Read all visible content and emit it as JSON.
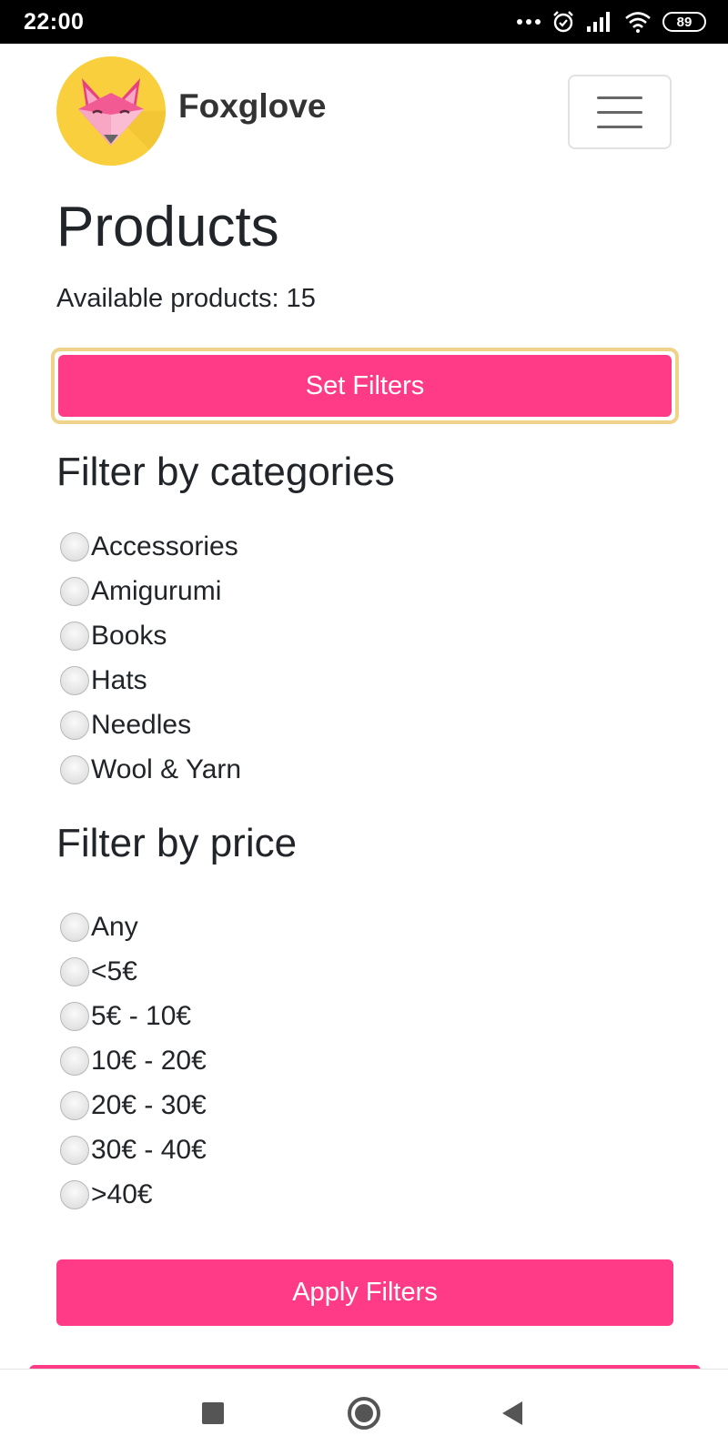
{
  "status_bar": {
    "time": "22:00",
    "battery": "89"
  },
  "header": {
    "brand_name": "Foxglove"
  },
  "main": {
    "title": "Products",
    "available_label": "Available products: 15",
    "set_filters_label": "Set Filters"
  },
  "categories_filter": {
    "heading": "Filter by categories",
    "options": [
      "Accessories",
      "Amigurumi",
      "Books",
      "Hats",
      "Needles",
      "Wool & Yarn"
    ]
  },
  "price_filter": {
    "heading": "Filter by price",
    "options": [
      "Any",
      "<5€",
      "5€ - 10€",
      "10€ - 20€",
      "20€ - 30€",
      "30€ - 40€",
      ">40€"
    ]
  },
  "apply_filters_label": "Apply Filters",
  "colors": {
    "accent": "#ff3b87",
    "focus_outline": "#f0d38a",
    "logo_background": "#f9cf3e"
  }
}
